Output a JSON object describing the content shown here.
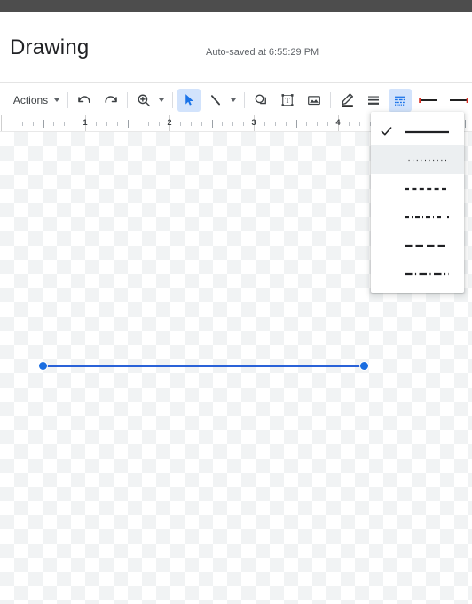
{
  "window": {
    "chrome_bar_color": "#4d4d4d"
  },
  "header": {
    "title": "Drawing",
    "autosave_status": "Auto-saved at 6:55:29 PM"
  },
  "toolbar": {
    "actions_label": "Actions",
    "items": [
      {
        "name": "actions-menu",
        "label": "Actions",
        "icon": "caret-down-icon"
      },
      {
        "name": "undo-button",
        "label": "Undo",
        "icon": "undo-icon"
      },
      {
        "name": "redo-button",
        "label": "Redo",
        "icon": "redo-icon"
      },
      {
        "name": "zoom-button",
        "label": "Zoom",
        "icon": "zoom-in-icon"
      },
      {
        "name": "select-tool",
        "label": "Select",
        "icon": "cursor-arrow-icon",
        "active": true
      },
      {
        "name": "line-tool",
        "label": "Line",
        "icon": "line-icon"
      },
      {
        "name": "shape-tool",
        "label": "Shape",
        "icon": "shape-icon"
      },
      {
        "name": "text-box-tool",
        "label": "Text box",
        "icon": "text-box-icon"
      },
      {
        "name": "image-tool",
        "label": "Image",
        "icon": "image-icon"
      },
      {
        "name": "border-color",
        "label": "Border color",
        "icon": "pencil-icon"
      },
      {
        "name": "border-weight",
        "label": "Border weight",
        "icon": "line-weight-icon"
      },
      {
        "name": "border-dash",
        "label": "Border dash",
        "icon": "border-dash-icon",
        "active": true
      },
      {
        "name": "line-start",
        "label": "Line start",
        "icon": "line-start-icon"
      },
      {
        "name": "line-end",
        "label": "Line end",
        "icon": "line-end-icon"
      }
    ]
  },
  "ruler": {
    "numbers": [
      "1",
      "2",
      "3",
      "4"
    ],
    "unit": "inches"
  },
  "canvas": {
    "shape": {
      "type": "line",
      "color": "#2a62d8",
      "selected": true,
      "handles": 2
    }
  },
  "border_dash_menu": {
    "open": true,
    "options": [
      {
        "name": "dash-solid",
        "style": "solid",
        "checked": true,
        "hovered": false
      },
      {
        "name": "dash-dotted",
        "style": "dotted",
        "checked": false,
        "hovered": true
      },
      {
        "name": "dash-dashed",
        "style": "dashed",
        "checked": false,
        "hovered": false
      },
      {
        "name": "dash-dash-dot",
        "style": "dash-dot",
        "checked": false,
        "hovered": false
      },
      {
        "name": "dash-long-dash",
        "style": "long-dash",
        "checked": false,
        "hovered": false
      },
      {
        "name": "dash-long-dash-dot",
        "style": "long-dash-dot",
        "checked": false,
        "hovered": false
      }
    ]
  }
}
